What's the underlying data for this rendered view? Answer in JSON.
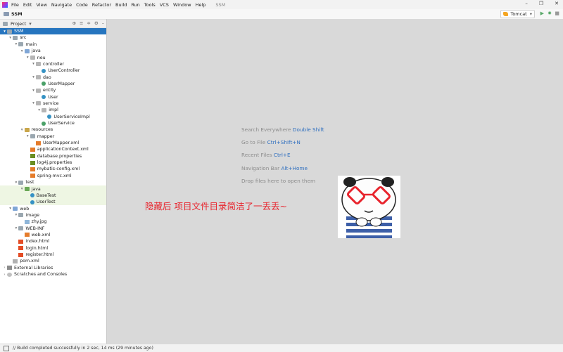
{
  "menu": {
    "items": [
      {
        "label": "File"
      },
      {
        "label": "Edit"
      },
      {
        "label": "View"
      },
      {
        "label": "Navigate"
      },
      {
        "label": "Code"
      },
      {
        "label": "Refactor"
      },
      {
        "label": "Build"
      },
      {
        "label": "Run"
      },
      {
        "label": "Tools"
      },
      {
        "label": "VCS"
      },
      {
        "label": "Window"
      },
      {
        "label": "Help"
      }
    ],
    "project_title": "SSM"
  },
  "window_controls": {
    "minimize": "–",
    "maximize": "❐",
    "close": "✕"
  },
  "navbar": {
    "project": "SSM",
    "run_config": "Tomcat",
    "run_config_arrow": "▾",
    "run_symbol": "▶",
    "debug_symbol": "✹",
    "stop_symbol": "■"
  },
  "tool_window": {
    "title": "Project",
    "dropdown": "▾",
    "icons": [
      "⊕",
      "≡",
      "≑",
      "⚙",
      "–"
    ]
  },
  "tree": [
    {
      "label": "SSM",
      "depth": 0,
      "arrow": "▾",
      "icon": "folder",
      "selected": true
    },
    {
      "label": "src",
      "depth": 1,
      "arrow": "▾",
      "icon": "folder"
    },
    {
      "label": "main",
      "depth": 2,
      "arrow": "▾",
      "icon": "folder"
    },
    {
      "label": "java",
      "depth": 3,
      "arrow": "▾",
      "icon": "folder src"
    },
    {
      "label": "neu",
      "depth": 4,
      "arrow": "▾",
      "icon": "pkg"
    },
    {
      "label": "controller",
      "depth": 5,
      "arrow": "▾",
      "icon": "pkg"
    },
    {
      "label": "UserController",
      "depth": 6,
      "arrow": "",
      "icon": "cls"
    },
    {
      "label": "dao",
      "depth": 5,
      "arrow": "▾",
      "icon": "pkg"
    },
    {
      "label": "UserMapper",
      "depth": 6,
      "arrow": "",
      "icon": "iface"
    },
    {
      "label": "entity",
      "depth": 5,
      "arrow": "▾",
      "icon": "pkg"
    },
    {
      "label": "User",
      "depth": 6,
      "arrow": "",
      "icon": "cls"
    },
    {
      "label": "service",
      "depth": 5,
      "arrow": "▾",
      "icon": "pkg"
    },
    {
      "label": "impl",
      "depth": 6,
      "arrow": "▾",
      "icon": "pkg"
    },
    {
      "label": "UserServiceImpl",
      "depth": 7,
      "arrow": "",
      "icon": "cls"
    },
    {
      "label": "UserService",
      "depth": 6,
      "arrow": "",
      "icon": "iface"
    },
    {
      "label": "resources",
      "depth": 3,
      "arrow": "▾",
      "icon": "folder res"
    },
    {
      "label": "mapper",
      "depth": 4,
      "arrow": "▾",
      "icon": "folder"
    },
    {
      "label": "UserMapper.xml",
      "depth": 5,
      "arrow": "",
      "icon": "xml"
    },
    {
      "label": "applicationContext.xml",
      "depth": 4,
      "arrow": "",
      "icon": "xml"
    },
    {
      "label": "database.properties",
      "depth": 4,
      "arrow": "",
      "icon": "props"
    },
    {
      "label": "log4j.properties",
      "depth": 4,
      "arrow": "",
      "icon": "props"
    },
    {
      "label": "mybatis-config.xml",
      "depth": 4,
      "arrow": "",
      "icon": "xml"
    },
    {
      "label": "spring-mvc.xml",
      "depth": 4,
      "arrow": "",
      "icon": "xml"
    },
    {
      "label": "test",
      "depth": 2,
      "arrow": "▾",
      "icon": "folder"
    },
    {
      "label": "java",
      "depth": 3,
      "arrow": "▾",
      "icon": "folder testf",
      "test": true
    },
    {
      "label": "BaseTest",
      "depth": 4,
      "arrow": "",
      "icon": "cls",
      "test": true
    },
    {
      "label": "UserTest",
      "depth": 4,
      "arrow": "",
      "icon": "cls",
      "test": true
    },
    {
      "label": "web",
      "depth": 1,
      "arrow": "▾",
      "icon": "folder web"
    },
    {
      "label": "image",
      "depth": 2,
      "arrow": "▾",
      "icon": "folder"
    },
    {
      "label": "zhy.jpg",
      "depth": 3,
      "arrow": "",
      "icon": "img"
    },
    {
      "label": "WEB-INF",
      "depth": 2,
      "arrow": "▾",
      "icon": "folder"
    },
    {
      "label": "web.xml",
      "depth": 3,
      "arrow": "",
      "icon": "xml"
    },
    {
      "label": "index.html",
      "depth": 2,
      "arrow": "",
      "icon": "html"
    },
    {
      "label": "login.html",
      "depth": 2,
      "arrow": "",
      "icon": "html"
    },
    {
      "label": "register.html",
      "depth": 2,
      "arrow": "",
      "icon": "html"
    },
    {
      "label": "pom.xml",
      "depth": 1,
      "arrow": "",
      "icon": "mvn"
    },
    {
      "label": "External Libraries",
      "depth": 0,
      "arrow": "›",
      "icon": "lib"
    },
    {
      "label": "Scratches and Consoles",
      "depth": 0,
      "arrow": "›",
      "icon": "scratch"
    }
  ],
  "editor": {
    "hints": [
      {
        "text": "Search Everywhere",
        "key": "Double Shift"
      },
      {
        "text": "Go to File",
        "key": "Ctrl+Shift+N"
      },
      {
        "text": "Recent Files",
        "key": "Ctrl+E"
      },
      {
        "text": "Navigation Bar",
        "key": "Alt+Home"
      },
      {
        "text": "Drop files here to open them",
        "key": ""
      }
    ],
    "overlay_caption": "隐藏后 项目文件目录简洁了一丢丢~"
  },
  "statusbar": {
    "message": "// Build completed successfully in 2 sec, 14 ms (29 minutes ago)"
  },
  "colors": {
    "selection": "#2675bf",
    "caption": "#e8242d",
    "shortcut": "#2f6fbf",
    "test_bg": "#eef6e3"
  }
}
